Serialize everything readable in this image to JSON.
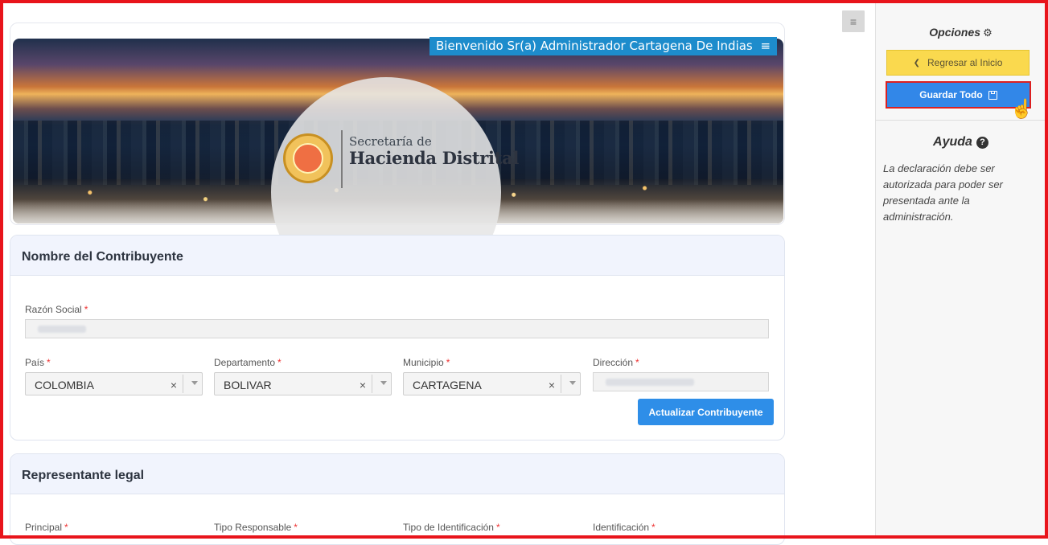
{
  "banner": {
    "welcome_text": "Bienvenido Sr(a) Administrador Cartagena De Indias",
    "logo_small": "Secretaría de",
    "logo_big": "Hacienda Distrital"
  },
  "sections": {
    "contribuyente": {
      "title": "Nombre del Contribuyente",
      "razon_social_label": "Razón Social",
      "pais_label": "País",
      "pais_value": "COLOMBIA",
      "departamento_label": "Departamento",
      "departamento_value": "BOLIVAR",
      "municipio_label": "Municipio",
      "municipio_value": "CARTAGENA",
      "direccion_label": "Dirección",
      "update_button": "Actualizar Contribuyente"
    },
    "representante": {
      "title": "Representante legal",
      "principal_label": "Principal",
      "tipo_responsable_label": "Tipo Responsable",
      "tipo_identificacion_label": "Tipo de Identificación",
      "identificacion_label": "Identificación"
    }
  },
  "sidebar": {
    "options_title": "Opciones",
    "back_label": "Regresar al Inicio",
    "save_label": "Guardar Todo",
    "help_title": "Ayuda",
    "help_text": "La declaración debe ser autorizada para poder ser presentada ante la administración."
  },
  "glyphs": {
    "required": "*",
    "clear": "×",
    "menu": "≡",
    "gear": "⚙",
    "chevron_left": "❮",
    "help": "?",
    "pointer": "☝"
  },
  "colors": {
    "frame": "#e8141b",
    "welcome_bg": "#1d8ccc",
    "primary_button": "#2e8ee8",
    "back_button": "#fad94e",
    "section_header_bg": "#f1f4fd"
  }
}
